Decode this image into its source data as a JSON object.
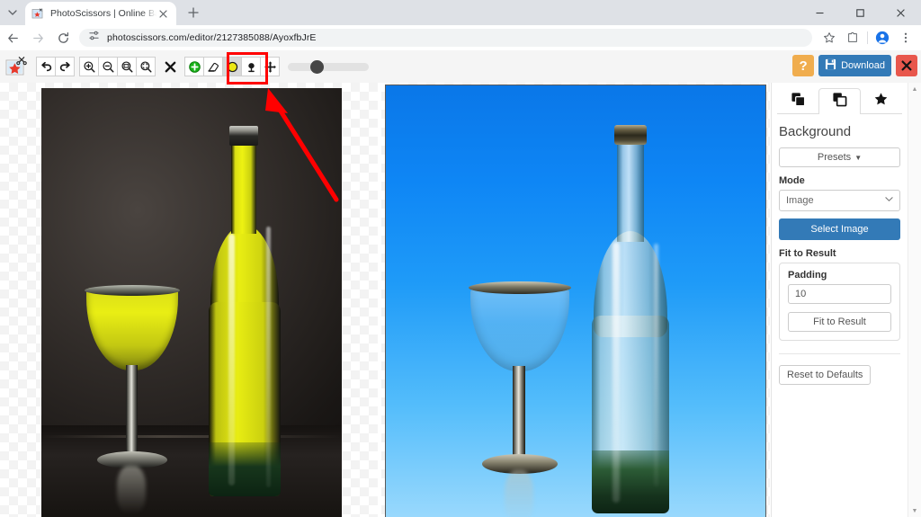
{
  "browser": {
    "tab": {
      "title": "PhotoScissors | Online Backgro",
      "favicon_icon": "photoscissors-favicon",
      "close_icon": "close-icon"
    },
    "tab_search_icon": "chevron-down-icon",
    "new_tab_icon": "plus-icon",
    "window_controls": {
      "minimize_icon": "minimize-icon",
      "maximize_icon": "maximize-icon",
      "close_icon": "close-icon"
    },
    "nav": {
      "back_icon": "arrow-back-icon",
      "forward_icon": "arrow-forward-icon",
      "reload_icon": "reload-icon"
    },
    "address": {
      "site_info_icon": "tune-site-settings-icon",
      "url": "photoscissors.com/editor/2127385088/AyoxfbJrE"
    },
    "omnibox_right": {
      "bookmark_icon": "star-icon",
      "extensions_icon": "extensions-puzzle-icon",
      "profile_icon": "profile-avatar-icon",
      "menu_icon": "three-dot-menu-icon"
    }
  },
  "toolbar": {
    "logo_icon": "photoscissors-logo",
    "buttons": [
      {
        "name": "undo",
        "icon": "undo-arrow-icon",
        "active": false
      },
      {
        "name": "redo",
        "icon": "redo-arrow-icon",
        "active": false
      },
      {
        "name": "zoom-in",
        "icon": "magnifier-plus-icon",
        "active": false
      },
      {
        "name": "zoom-out",
        "icon": "magnifier-minus-icon",
        "active": false
      },
      {
        "name": "zoom-fit-width",
        "icon": "magnifier-fit-width-icon",
        "active": false
      },
      {
        "name": "zoom-fit-page",
        "icon": "magnifier-fit-page-icon",
        "active": false
      },
      {
        "name": "clear-marks",
        "icon": "black-x-icon",
        "active": false
      },
      {
        "name": "add-marker",
        "icon": "green-plus-circle-icon",
        "active": false
      },
      {
        "name": "eraser",
        "icon": "eraser-icon",
        "active": false
      },
      {
        "name": "foreground-marker",
        "icon": "yellow-circle-icon",
        "active": true
      },
      {
        "name": "background-marker",
        "icon": "black-marker-icon",
        "active": false
      },
      {
        "name": "pan",
        "icon": "move-arrows-icon",
        "active": false
      }
    ],
    "brush_slider": {
      "name": "brush-size-slider",
      "value_percent": 28
    },
    "help_label": "?",
    "download_label": "Download",
    "download_icon": "floppy-disk-icon",
    "close_label": "",
    "close_icon": "black-x-icon"
  },
  "annotations": {
    "highlight_box": {
      "target": "foreground-marker-button",
      "color": "#ff0000"
    },
    "arrow": {
      "color": "#ff0000",
      "points_to": "foreground-marker-button"
    }
  },
  "canvas": {
    "left_pane_name": "source-image-canvas",
    "right_pane_name": "result-preview-canvas",
    "left_image_alt": "wine bottle and glass on dark background with yellow foreground mask",
    "right_image_alt": "cut out bottle and glass on blue gradient background"
  },
  "panel": {
    "tabs": [
      {
        "name": "tab-foreground",
        "icon": "layers-filled-icon",
        "active": false
      },
      {
        "name": "tab-background",
        "icon": "layers-outline-icon",
        "active": true
      },
      {
        "name": "tab-effects",
        "icon": "star-icon",
        "active": false
      }
    ],
    "title": "Background",
    "presets_label": "Presets",
    "presets_caret_icon": "caret-down-icon",
    "mode_label": "Mode",
    "mode_value": "Image",
    "mode_caret_icon": "chevron-down-icon",
    "select_image_label": "Select Image",
    "fit_to_result_label": "Fit to Result",
    "padding_label": "Padding",
    "padding_value": "10",
    "fit_to_result_button_label": "Fit to Result",
    "reset_label": "Reset to Defaults",
    "accent_color": "#337ab7",
    "scroll_up_icon": "scroll-up-arrow-icon",
    "scroll_down_icon": "scroll-down-arrow-icon"
  }
}
